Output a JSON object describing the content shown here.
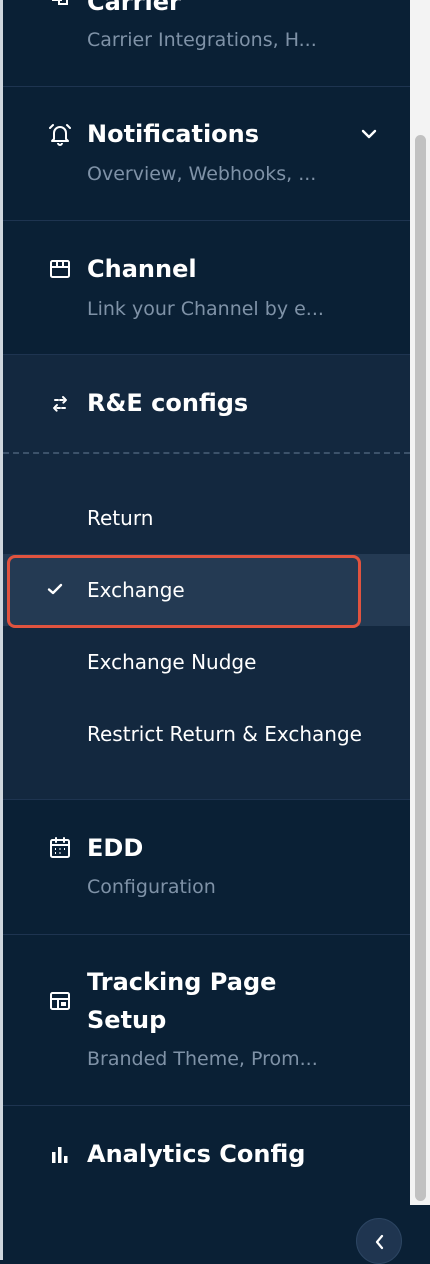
{
  "nav": {
    "carrier": {
      "title": "Carrier",
      "subtitle": "Carrier Integrations, H...",
      "icon": "carrier-icon"
    },
    "notifications": {
      "title": "Notifications",
      "subtitle": "Overview, Webhooks, ...",
      "icon": "bell-icon",
      "expand_icon": "chevron-down-icon"
    },
    "channel": {
      "title": "Channel",
      "subtitle": "Link your Channel by e...",
      "icon": "store-icon"
    },
    "rne": {
      "title": "R&E configs",
      "icon": "swap-arrows-icon",
      "items": [
        {
          "label": "Return",
          "active": false
        },
        {
          "label": "Exchange",
          "active": true
        },
        {
          "label": "Exchange Nudge",
          "active": false
        },
        {
          "label": "Restrict Return & Exchange",
          "active": false
        }
      ]
    },
    "edd": {
      "title": "EDD",
      "subtitle": "Configuration",
      "icon": "calendar-icon"
    },
    "tracking": {
      "title_line1": "Tracking Page",
      "title_line2": "Setup",
      "subtitle": "Branded Theme, Prom...",
      "icon": "layout-icon"
    },
    "analytics": {
      "title": "Analytics Config",
      "icon": "bar-chart-icon"
    }
  },
  "collapse_button": {
    "icon": "chevron-left-icon"
  },
  "colors": {
    "sidebar_bg": "#0a2035",
    "expanded_bg": "#13283f",
    "active_item_bg": "#243a53",
    "focus_ring": "#e0533f",
    "subtitle_text": "#7f92a7"
  }
}
